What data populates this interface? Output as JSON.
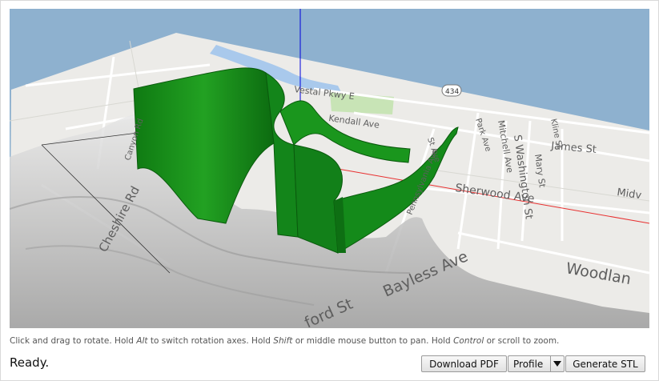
{
  "map_labels": {
    "vestal": "Vestal Pkwy E",
    "route": "434",
    "kendall": "Kendall Ave",
    "cheshire": "Cheshire Rd",
    "canyon": "Canyon Rd",
    "pennsylvania": "Pennsylvania Ave",
    "st_ave": "St Ave",
    "park": "Park Ave",
    "mitchell": "Mitchell Ave",
    "washington": "S Washington St",
    "mary": "Mary St",
    "kline": "Kline St",
    "james": "James St",
    "sherwood": "Sherwood Ave",
    "mid": "Midv",
    "bayless": "Bayless Ave",
    "woodlan": "Woodlan",
    "ford": "ford St"
  },
  "help": {
    "t1": "Click and drag to rotate. Hold ",
    "k1": "Alt",
    "t2": " to switch rotation axes. Hold ",
    "k2": "Shift",
    "t3": " or middle mouse button to pan. Hold ",
    "k3": "Control",
    "t4": " or scroll to zoom."
  },
  "status": "Ready.",
  "buttons": {
    "pdf": "Download PDF",
    "profile": "Profile",
    "stl": "Generate STL"
  },
  "colors": {
    "sky": "#8eb1cf",
    "map": "#ecebe8",
    "water": "#a9c9ec",
    "park": "#c8e4b6",
    "wall": "#1a8f1a"
  }
}
